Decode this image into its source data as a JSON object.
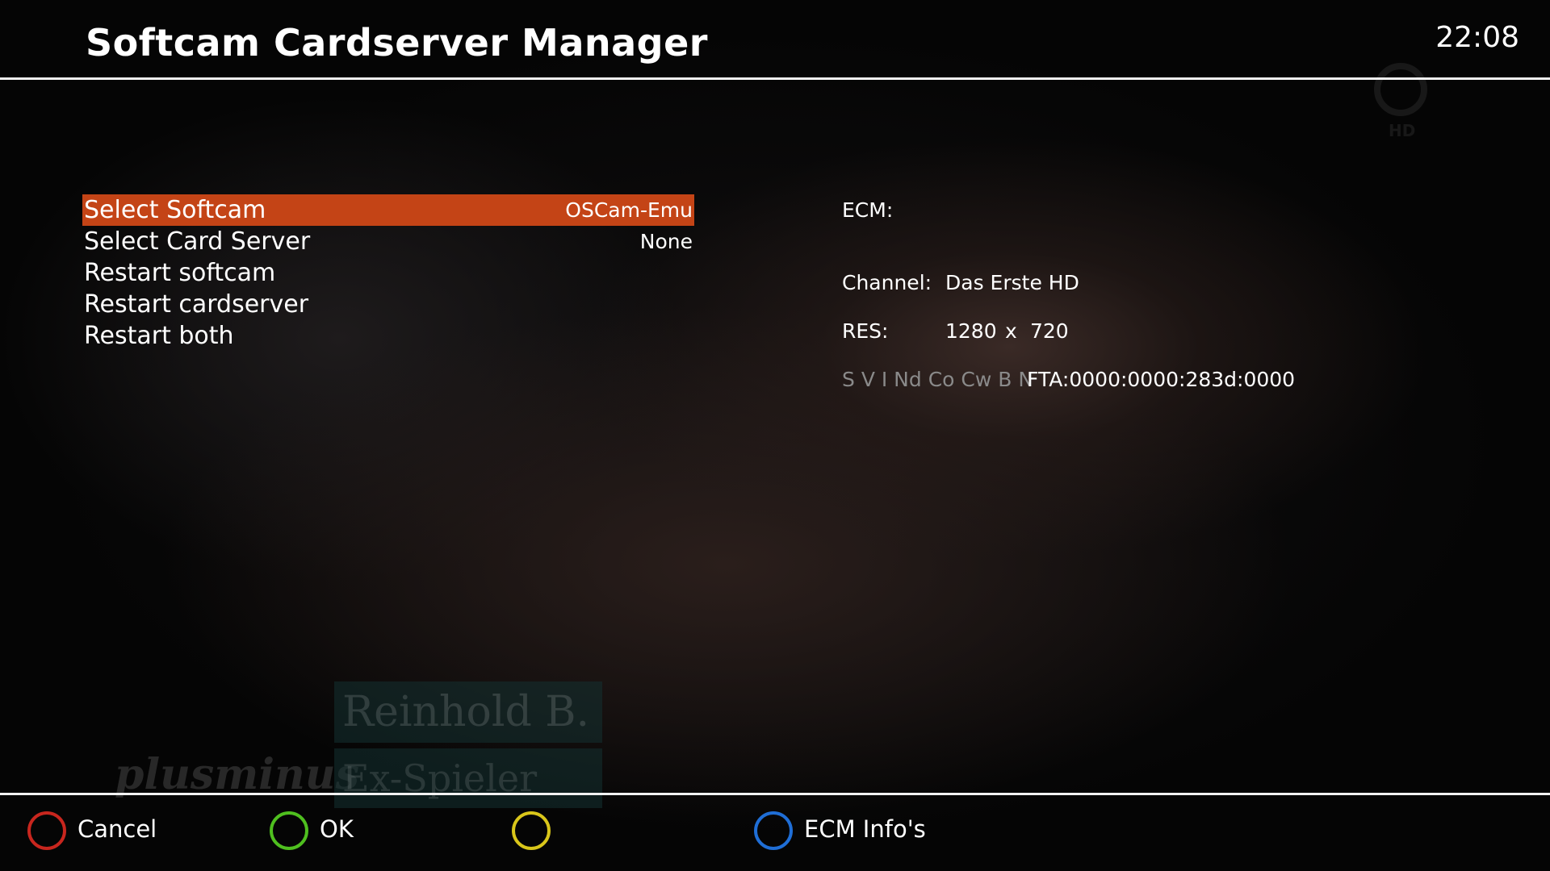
{
  "header": {
    "title": "Softcam Cardserver Manager",
    "clock": "22:08"
  },
  "channel_logo": {
    "badge": "HD"
  },
  "menu": {
    "items": [
      {
        "label": "Select Softcam",
        "value": "OSCam-Emu",
        "selected": true
      },
      {
        "label": "Select Card Server",
        "value": "None",
        "selected": false
      },
      {
        "label": "Restart softcam",
        "value": "",
        "selected": false
      },
      {
        "label": "Restart cardserver",
        "value": "",
        "selected": false
      },
      {
        "label": "Restart both",
        "value": "",
        "selected": false
      }
    ]
  },
  "info": {
    "ecm_label": "ECM:",
    "channel_label": "Channel:",
    "channel_value": "Das Erste HD",
    "res_label": "RES:",
    "res_width": "1280",
    "res_x": "x",
    "res_height": "720",
    "caid_flags": "S V I Nd Co Cw B N",
    "caid_value": "FTA:0000:0000:283d:0000"
  },
  "background_overlay": {
    "name": "Reinhold B.",
    "role": "Ex-Spieler",
    "show": "plusminus"
  },
  "footer": {
    "keys": [
      {
        "color": "red",
        "hex": "#c8261e",
        "label": "Cancel"
      },
      {
        "color": "green",
        "hex": "#4fbf1f",
        "label": "OK"
      },
      {
        "color": "yellow",
        "hex": "#d9c61a",
        "label": ""
      },
      {
        "color": "blue",
        "hex": "#1f6ed6",
        "label": "ECM Info's"
      }
    ]
  },
  "colors": {
    "selection": "#c44416",
    "rule": "#f2f2f2",
    "muted_text": "#8a8a8a"
  }
}
